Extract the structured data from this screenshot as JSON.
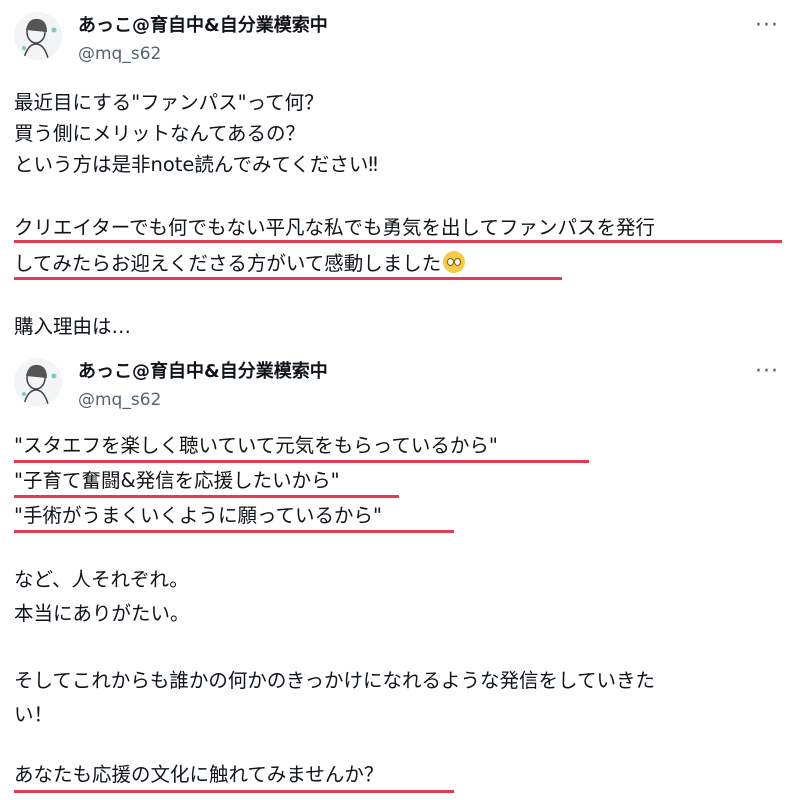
{
  "tweet": {
    "display_name": "あっこ@育自中&自分業模索中",
    "handle": "@mq_s62",
    "more_label": "···",
    "lines": [
      "最近目にする\"ファンパス\"って何？",
      "買う側にメリットなんてあるの？",
      "という方は是非note読んでみてください‼",
      "クリエイターでも何でもない平凡な私でも勇気を出してファンパスを発行",
      "してみたらお迎えくださる方がいて感動しました",
      "購入理由は…"
    ]
  },
  "quoted_tweet": {
    "display_name": "あっこ@育自中&自分業模索中",
    "handle": "@mq_s62",
    "more_label": "···",
    "lines": [
      "\"スタエフを楽しく聴いていて元気をもらっているから\"",
      "\"子育て奮闘&発信を応援したいから\"",
      "\"手術がうまくいくように願っているから\"",
      "など、人それぞれ。",
      "本当にありがたい。",
      "そしてこれからも誰かの何かのきっかけになれるような発信をしていきた",
      "い！",
      "あなたも応援の文化に触れてみませんか？"
    ]
  },
  "colors": {
    "underline": "#e23c55",
    "secondary_text": "#536471",
    "text": "#0f1419"
  },
  "icons": [
    "avatar-image",
    "more-options-icon",
    "teary-smile-emoji"
  ]
}
